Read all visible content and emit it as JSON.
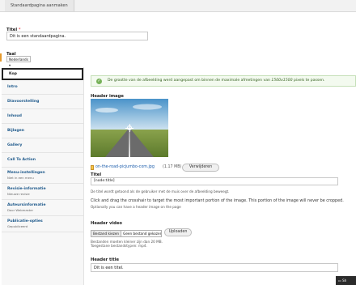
{
  "header": {
    "tab_label": "Standaardpagina aanmaken"
  },
  "form": {
    "title_label": "Titel",
    "title_required": "*",
    "title_value": "Dit is een standaardpagina.",
    "language_label": "Taal",
    "language_value": "Nederlands"
  },
  "vertical_tabs": [
    {
      "label": "Kop",
      "active": true
    },
    {
      "label": "Intro"
    },
    {
      "label": "Diavoorstelling"
    },
    {
      "label": "Inhoud"
    },
    {
      "label": "Bijlagen"
    },
    {
      "label": "Gallery"
    },
    {
      "label": "Call To Action"
    },
    {
      "label": "Menu-instellingen",
      "sub": "Niet in een menu"
    },
    {
      "label": "Revisie-informatie",
      "sub": "Nieuwe revisie"
    },
    {
      "label": "Auteursinformatie",
      "sub": "Door Webmaster"
    },
    {
      "label": "Publicatie-opties",
      "sub": "Gepubliceerd"
    }
  ],
  "message": {
    "text_before": "De grootte van de afbeelding werd aangepast om binnen de maximale afmetingen van ",
    "dimensions": "1500x1500",
    "text_after": " pixels te passen."
  },
  "header_image": {
    "label": "Header image",
    "file_name": "on-the-road-picjumbo-com.jpg",
    "file_size": "(1.17 MB)",
    "remove_button": "Verwijderen",
    "title_label": "Titel",
    "title_value": "[node:title]",
    "title_help": "De titel wordt getoond als de gebruiker met de muis over de afbeelding beweegt.",
    "crop_help": "Click and drag the crosshair to target the most important portion of the image. This portion of the image will never be cropped.",
    "crop_help_sub": "Optionally you can have a header image on the page"
  },
  "header_video": {
    "label": "Header video",
    "choose_label": "Bestand kiezen",
    "no_file_label": "Geen bestand gekozen",
    "upload_button": "Uploaden",
    "help_1": "Bestanden moeten kleiner zijn dan 20 MB.",
    "help_2": "Toegestane bestandstypen: mp4."
  },
  "header_title": {
    "label": "Header title",
    "value": "Dit is een titel."
  },
  "corner_label": "Sh",
  "colors": {
    "link": "#1f5a8c",
    "success_bg": "#f3faef",
    "success_icon": "#77b259",
    "required": "#e0242b",
    "focus_marker": "#e59a2c"
  }
}
